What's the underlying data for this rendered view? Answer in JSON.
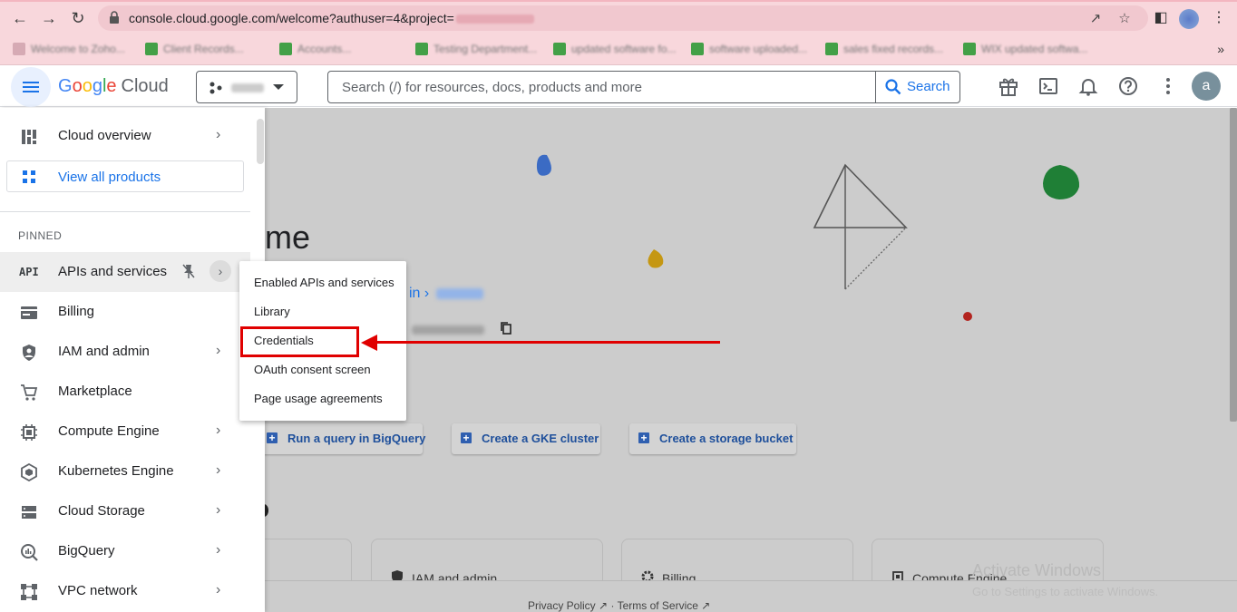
{
  "browser": {
    "url_text": "console.cloud.google.com/welcome?authuser=4&project=",
    "bookmarks": [
      "Welcome to Zoho...",
      "Client Records...",
      "Accounts...",
      "Testing Department...",
      "updated software fo...",
      "software uploaded...",
      "sales fixed records...",
      "WIX updated softwa..."
    ]
  },
  "header": {
    "logo_google": "Google",
    "logo_cloud": "Cloud",
    "search_placeholder": "Search (/) for resources, docs, products and more",
    "search_button": "Search",
    "avatar_letter": "a"
  },
  "sidebar": {
    "cloud_overview": "Cloud overview",
    "view_all_products": "View all products",
    "pinned_label": "PINNED",
    "items": [
      {
        "label": "APIs and services",
        "icon": "api-icon",
        "chevron": true,
        "active": true
      },
      {
        "label": "Billing",
        "icon": "billing-icon",
        "chevron": false
      },
      {
        "label": "IAM and admin",
        "icon": "shield-icon",
        "chevron": true
      },
      {
        "label": "Marketplace",
        "icon": "cart-icon",
        "chevron": false
      },
      {
        "label": "Compute Engine",
        "icon": "chip-icon",
        "chevron": true
      },
      {
        "label": "Kubernetes Engine",
        "icon": "kubernetes-icon",
        "chevron": true
      },
      {
        "label": "Cloud Storage",
        "icon": "storage-icon",
        "chevron": true
      },
      {
        "label": "BigQuery",
        "icon": "bigquery-icon",
        "chevron": true
      },
      {
        "label": "VPC network",
        "icon": "network-icon",
        "chevron": true
      }
    ]
  },
  "flyout": {
    "items": [
      "Enabled APIs and services",
      "Library",
      "Credentials",
      "OAuth consent screen",
      "Page usage agreements"
    ],
    "highlighted": "Credentials"
  },
  "main": {
    "welcome_partial": "me",
    "crumb_partial": "in",
    "actions": [
      "Run a query in BigQuery",
      "Create a GKE cluster",
      "Create a storage bucket"
    ],
    "cards": [
      "IAM and admin",
      "Billing",
      "Compute Engine"
    ],
    "footer_privacy": "Privacy Policy",
    "footer_sep": "·",
    "footer_terms": "Terms of Service",
    "activate_title": "Activate Windows",
    "activate_sub": "Go to Settings to activate Windows."
  },
  "colors": {
    "accent": "#1a73e8",
    "annotation": "#e00000",
    "chrome": "#f8d7dc"
  }
}
